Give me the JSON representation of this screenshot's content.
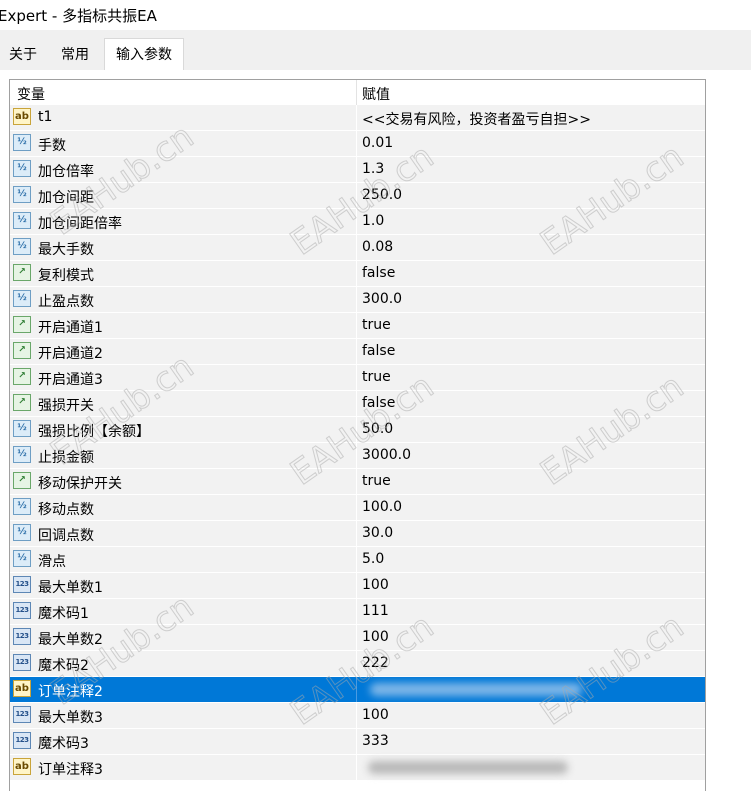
{
  "window": {
    "title": "Expert - 多指标共振EA"
  },
  "tabs": [
    "关于",
    "常用",
    "输入参数"
  ],
  "grid": {
    "headers": {
      "variable": "变量",
      "value": "赋值"
    },
    "rows": [
      {
        "icon": "string-icon",
        "glyph": "ab",
        "type": "str",
        "name": "t1",
        "value": "<<交易有风险，投资者盈亏自担>>"
      },
      {
        "icon": "double-icon",
        "glyph": "½",
        "type": "dbl",
        "name": "手数",
        "value": "0.01"
      },
      {
        "icon": "double-icon",
        "glyph": "½",
        "type": "dbl",
        "name": "加仓倍率",
        "value": "1.3"
      },
      {
        "icon": "double-icon",
        "glyph": "½",
        "type": "dbl",
        "name": "加仓间距",
        "value": "250.0"
      },
      {
        "icon": "double-icon",
        "glyph": "½",
        "type": "dbl",
        "name": "加仓间距倍率",
        "value": "1.0"
      },
      {
        "icon": "double-icon",
        "glyph": "½",
        "type": "dbl",
        "name": "最大手数",
        "value": "0.08"
      },
      {
        "icon": "bool-icon",
        "glyph": "↗",
        "type": "bool",
        "name": "复利模式",
        "value": "false"
      },
      {
        "icon": "double-icon",
        "glyph": "½",
        "type": "dbl",
        "name": "止盈点数",
        "value": "300.0"
      },
      {
        "icon": "bool-icon",
        "glyph": "↗",
        "type": "bool",
        "name": "开启通道1",
        "value": "true"
      },
      {
        "icon": "bool-icon",
        "glyph": "↗",
        "type": "bool",
        "name": "开启通道2",
        "value": "false"
      },
      {
        "icon": "bool-icon",
        "glyph": "↗",
        "type": "bool",
        "name": "开启通道3",
        "value": "true"
      },
      {
        "icon": "bool-icon",
        "glyph": "↗",
        "type": "bool",
        "name": "强损开关",
        "value": "false"
      },
      {
        "icon": "double-icon",
        "glyph": "½",
        "type": "dbl",
        "name": "强损比例【余额】",
        "value": "50.0"
      },
      {
        "icon": "double-icon",
        "glyph": "½",
        "type": "dbl",
        "name": "止损金额",
        "value": "3000.0"
      },
      {
        "icon": "bool-icon",
        "glyph": "↗",
        "type": "bool",
        "name": "移动保护开关",
        "value": "true"
      },
      {
        "icon": "double-icon",
        "glyph": "½",
        "type": "dbl",
        "name": "移动点数",
        "value": "100.0"
      },
      {
        "icon": "double-icon",
        "glyph": "½",
        "type": "dbl",
        "name": "回调点数",
        "value": "30.0"
      },
      {
        "icon": "double-icon",
        "glyph": "½",
        "type": "dbl",
        "name": "滑点",
        "value": "5.0"
      },
      {
        "icon": "integer-icon",
        "glyph": "123",
        "type": "int",
        "name": "最大单数1",
        "value": "100"
      },
      {
        "icon": "integer-icon",
        "glyph": "123",
        "type": "int",
        "name": "魔术码1",
        "value": "111"
      },
      {
        "icon": "integer-icon",
        "glyph": "123",
        "type": "int",
        "name": "最大单数2",
        "value": "100"
      },
      {
        "icon": "integer-icon",
        "glyph": "123",
        "type": "int",
        "name": "魔术码2",
        "value": "222"
      },
      {
        "icon": "string-icon",
        "glyph": "ab",
        "type": "str",
        "name": "订单注释2",
        "value": "",
        "selected": true,
        "blurred": true
      },
      {
        "icon": "integer-icon",
        "glyph": "123",
        "type": "int",
        "name": "最大单数3",
        "value": "100"
      },
      {
        "icon": "integer-icon",
        "glyph": "123",
        "type": "int",
        "name": "魔术码3",
        "value": "333"
      },
      {
        "icon": "string-icon",
        "glyph": "ab",
        "type": "str",
        "name": "订单注释3",
        "value": "",
        "blurred": true
      }
    ]
  },
  "watermark": {
    "text": "EAHub.cn"
  }
}
